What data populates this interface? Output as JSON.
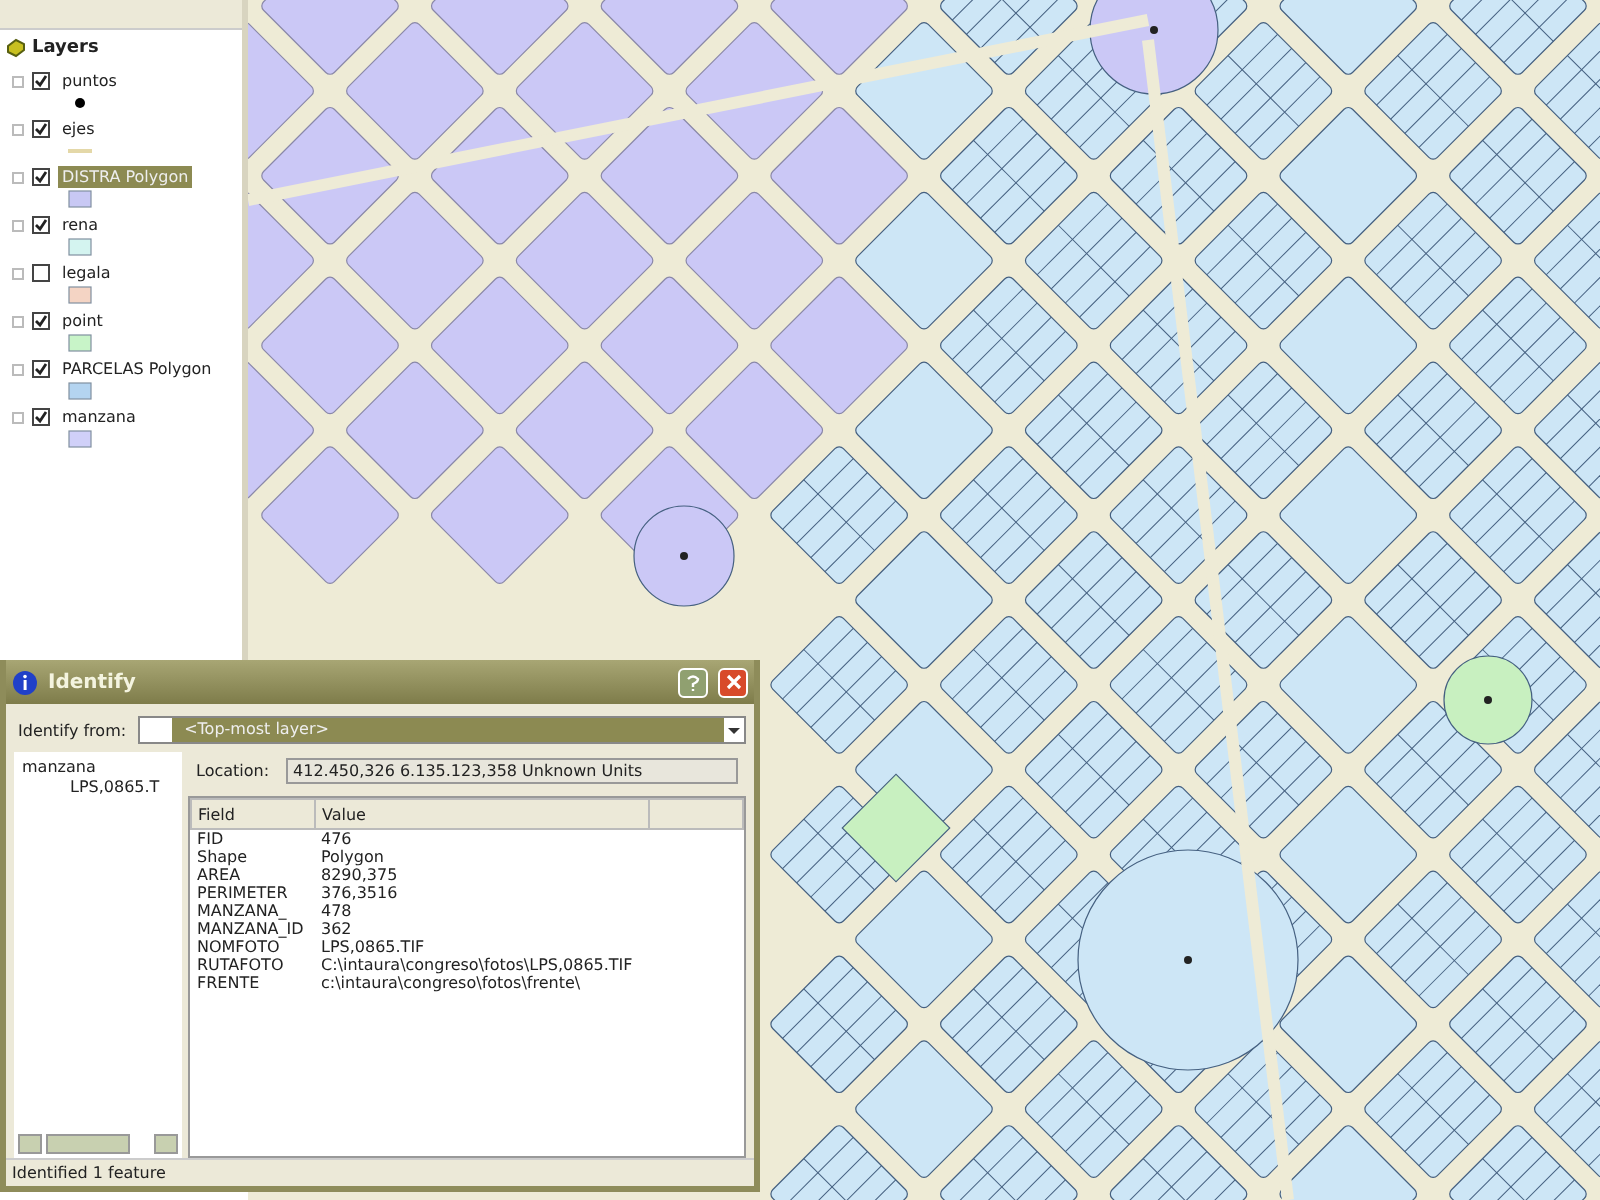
{
  "layers_panel": {
    "title": "Layers",
    "layers": [
      {
        "name": "puntos",
        "checked": true,
        "selected": false,
        "kind": "point",
        "color": "#000000"
      },
      {
        "name": "ejes",
        "checked": true,
        "selected": false,
        "kind": "line",
        "color": "#e4d8a8"
      },
      {
        "name": "DISTRA Polygon",
        "checked": true,
        "selected": true,
        "kind": "fill",
        "color": "#c8c8f4"
      },
      {
        "name": "rena",
        "checked": true,
        "selected": false,
        "kind": "fill",
        "color": "#d4f4f0"
      },
      {
        "name": "legala",
        "checked": false,
        "selected": false,
        "kind": "fill",
        "color": "#f4d4c4"
      },
      {
        "name": "point",
        "checked": true,
        "selected": false,
        "kind": "fill",
        "color": "#c8f4c8"
      },
      {
        "name": "PARCELAS Polygon",
        "checked": true,
        "selected": false,
        "kind": "fill",
        "color": "#b4d4f0"
      },
      {
        "name": "manzana",
        "checked": true,
        "selected": false,
        "kind": "fill",
        "color": "#d0d0f8"
      }
    ]
  },
  "identify_dialog": {
    "title": "Identify",
    "identify_from_label": "Identify from:",
    "identify_from_value": "<Top-most layer>",
    "tree": [
      {
        "label": "manzana",
        "children": [
          {
            "label": "LPS,0865.T"
          }
        ]
      }
    ],
    "location_label": "Location:",
    "location_value": "412.450,326  6.135.123,358 Unknown Units",
    "columns": [
      "Field",
      "Value"
    ],
    "rows": [
      {
        "field": "FID",
        "value": "476"
      },
      {
        "field": "Shape",
        "value": "Polygon"
      },
      {
        "field": "AREA",
        "value": "8290,375"
      },
      {
        "field": "PERIMETER",
        "value": "376,3516"
      },
      {
        "field": "MANZANA_",
        "value": "478"
      },
      {
        "field": "MANZANA_ID",
        "value": "362"
      },
      {
        "field": "NOMFOTO",
        "value": "LPS,0865.TIF"
      },
      {
        "field": "RUTAFOTO",
        "value": "C:\\intaura\\congreso\\fotos\\LPS,0865.TIF"
      },
      {
        "field": "FRENTE",
        "value": "c:\\intaura\\congreso\\fotos\\frente\\"
      }
    ],
    "status": "Identified 1 feature"
  }
}
